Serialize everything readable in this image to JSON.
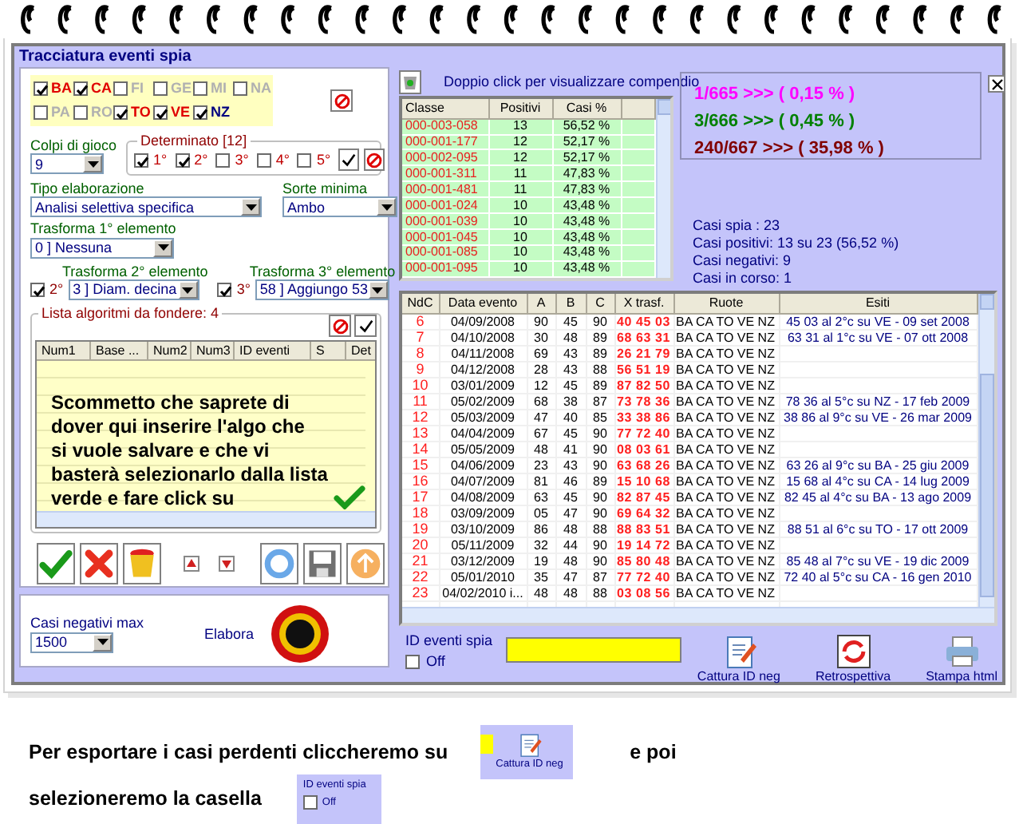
{
  "window": {
    "title": "Tracciatura eventi spia"
  },
  "ruote": [
    {
      "label": "BA",
      "checked": true,
      "color": "#e00000"
    },
    {
      "label": "CA",
      "checked": true,
      "color": "#e00000"
    },
    {
      "label": "FI",
      "checked": false,
      "color": "#b0b0b0"
    },
    {
      "label": "GE",
      "checked": false,
      "color": "#b0b0b0"
    },
    {
      "label": "MI",
      "checked": false,
      "color": "#b0b0b0"
    },
    {
      "label": "NA",
      "checked": false,
      "color": "#b0b0b0"
    },
    {
      "label": "PA",
      "checked": false,
      "color": "#b0b0b0"
    },
    {
      "label": "RO",
      "checked": false,
      "color": "#b0b0b0"
    },
    {
      "label": "TO",
      "checked": true,
      "color": "#e00000"
    },
    {
      "label": "VE",
      "checked": true,
      "color": "#e00000"
    },
    {
      "label": "NZ",
      "checked": true,
      "color": "#000080"
    }
  ],
  "colpi": {
    "label": "Colpi di gioco",
    "value": "9"
  },
  "determinato": {
    "legend": "Determinato [12]",
    "positions": [
      {
        "label": "1°",
        "checked": true
      },
      {
        "label": "2°",
        "checked": true
      },
      {
        "label": "3°",
        "checked": false
      },
      {
        "label": "4°",
        "checked": false
      },
      {
        "label": "5°",
        "checked": false
      }
    ]
  },
  "tipo": {
    "label": "Tipo elaborazione",
    "value": "Analisi selettiva specifica"
  },
  "sorte": {
    "label": "Sorte minima",
    "value": "Ambo"
  },
  "trasforma1": {
    "label": "Trasforma 1° elemento",
    "value": "0 ] Nessuna"
  },
  "trasforma2": {
    "label": "Trasforma 2° elemento",
    "check_label": "2°",
    "checked": true,
    "value": "3 ] Diam. decina"
  },
  "trasforma3": {
    "label": "Trasforma 3° elemento",
    "check_label": "3°",
    "checked": true,
    "value": "58 ] Aggiungo 53"
  },
  "lista": {
    "legend": "Lista algoritmi da fondere: 4",
    "columns": [
      "Num1",
      "Base ...",
      "Num2",
      "Num3",
      "ID eventi",
      "S",
      "Det"
    ],
    "note": "Scommetto che saprete di\ndover qui inserire l'algo che\nsi vuole salvare e che vi\nbasterà selezionarlo dalla lista\nverde e fare click su"
  },
  "casi_negativi": {
    "label": "Casi negativi max",
    "value": "1500"
  },
  "elabora": {
    "label": "Elabora"
  },
  "compendio": {
    "hint": "Doppio click per visualizzare compendio",
    "columns": [
      "Classe",
      "Positivi",
      "Casi %"
    ],
    "rows": [
      [
        "000-003-058",
        "13",
        "56,52 %"
      ],
      [
        "000-001-177",
        "12",
        "52,17 %"
      ],
      [
        "000-002-095",
        "12",
        "52,17 %"
      ],
      [
        "000-001-311",
        "11",
        "47,83 %"
      ],
      [
        "000-001-481",
        "11",
        "47,83 %"
      ],
      [
        "000-001-024",
        "10",
        "43,48 %"
      ],
      [
        "000-001-039",
        "10",
        "43,48 %"
      ],
      [
        "000-001-045",
        "10",
        "43,48 %"
      ],
      [
        "000-001-085",
        "10",
        "43,48 %"
      ],
      [
        "000-001-095",
        "10",
        "43,48 %"
      ]
    ]
  },
  "stats": [
    {
      "text": "1/665 >>> ( 0,15 % )",
      "color": "#ff00ff"
    },
    {
      "text": "3/666 >>> ( 0,45 % )",
      "color": "#008000"
    },
    {
      "text": "240/667 >>> ( 35,98 % )",
      "color": "#800000"
    }
  ],
  "summary": [
    "Casi spia : 23",
    "Casi positivi: 13 su 23 (56,52 %)",
    "Casi negativi: 9",
    "Casi in corso: 1"
  ],
  "eventi": {
    "columns": [
      "NdC",
      "Data evento",
      "A",
      "B",
      "C",
      "X trasf.",
      "Ruote",
      "Esiti"
    ],
    "rows": [
      {
        "ndc": "6",
        "data": "04/09/2008",
        "a": "90",
        "b": "45",
        "c": "90",
        "trasf": "40 45 03",
        "ruote": "BA CA TO VE NZ",
        "esito": "45 03 al 2°c su VE - 09 set 2008"
      },
      {
        "ndc": "7",
        "data": "04/10/2008",
        "a": "30",
        "b": "48",
        "c": "89",
        "trasf": "68 63 31",
        "ruote": "BA CA TO VE NZ",
        "esito": "63 31 al 1°c su VE - 07 ott 2008"
      },
      {
        "ndc": "8",
        "data": "04/11/2008",
        "a": "69",
        "b": "43",
        "c": "89",
        "trasf": "26 21 79",
        "ruote": "BA CA TO VE NZ"
      },
      {
        "ndc": "9",
        "data": "04/12/2008",
        "a": "28",
        "b": "43",
        "c": "88",
        "trasf": "56 51 19",
        "ruote": "BA CA TO VE NZ"
      },
      {
        "ndc": "10",
        "data": "03/01/2009",
        "a": "12",
        "b": "45",
        "c": "89",
        "trasf": "87 82 50",
        "ruote": "BA CA TO VE NZ"
      },
      {
        "ndc": "11",
        "data": "05/02/2009",
        "a": "68",
        "b": "38",
        "c": "87",
        "trasf": "73 78 36",
        "ruote": "BA CA TO VE NZ",
        "esito": "78 36 al 5°c su NZ - 17 feb 2009"
      },
      {
        "ndc": "12",
        "data": "05/03/2009",
        "a": "47",
        "b": "40",
        "c": "85",
        "trasf": "33 38 86",
        "ruote": "BA CA TO VE NZ",
        "esito": "38 86 al 9°c su VE - 26 mar 2009"
      },
      {
        "ndc": "13",
        "data": "04/04/2009",
        "a": "67",
        "b": "45",
        "c": "90",
        "trasf": "77 72 40",
        "ruote": "BA CA TO VE NZ"
      },
      {
        "ndc": "14",
        "data": "05/05/2009",
        "a": "48",
        "b": "41",
        "c": "90",
        "trasf": "08 03 61",
        "ruote": "BA CA TO VE NZ"
      },
      {
        "ndc": "15",
        "data": "04/06/2009",
        "a": "23",
        "b": "43",
        "c": "90",
        "trasf": "63 68 26",
        "ruote": "BA CA TO VE NZ",
        "esito": "63 26 al 9°c su BA - 25 giu 2009"
      },
      {
        "ndc": "16",
        "data": "04/07/2009",
        "a": "81",
        "b": "46",
        "c": "89",
        "trasf": "15 10 68",
        "ruote": "BA CA TO VE NZ",
        "esito": "15 68 al 4°c su CA - 14 lug 2009"
      },
      {
        "ndc": "17",
        "data": "04/08/2009",
        "a": "63",
        "b": "45",
        "c": "90",
        "trasf": "82 87 45",
        "ruote": "BA CA TO VE NZ",
        "esito": "82 45 al 4°c su BA - 13 ago 2009"
      },
      {
        "ndc": "18",
        "data": "03/09/2009",
        "a": "05",
        "b": "47",
        "c": "90",
        "trasf": "69 64 32",
        "ruote": "BA CA TO VE NZ"
      },
      {
        "ndc": "19",
        "data": "03/10/2009",
        "a": "86",
        "b": "48",
        "c": "88",
        "trasf": "88 83 51",
        "ruote": "BA CA TO VE NZ",
        "esito": "88 51 al 6°c su TO - 17 ott 2009"
      },
      {
        "ndc": "20",
        "data": "05/11/2009",
        "a": "32",
        "b": "44",
        "c": "90",
        "trasf": "19 14 72",
        "ruote": "BA CA TO VE NZ"
      },
      {
        "ndc": "21",
        "data": "03/12/2009",
        "a": "19",
        "b": "48",
        "c": "90",
        "trasf": "85 80 48",
        "ruote": "BA CA TO VE NZ",
        "esito": "85 48 al 7°c su VE - 19 dic 2009"
      },
      {
        "ndc": "22",
        "data": "05/01/2010",
        "a": "35",
        "b": "47",
        "c": "87",
        "trasf": "77 72 40",
        "ruote": "BA CA TO VE NZ",
        "esito": "72 40 al 5°c su CA - 16 gen 2010"
      },
      {
        "ndc": "23",
        "data": "04/02/2010 i...",
        "a": "48",
        "b": "48",
        "c": "88",
        "trasf": "03 08 56",
        "ruote": "BA CA TO VE NZ"
      }
    ]
  },
  "id_eventi": {
    "label": "ID eventi spia",
    "off_label": "Off",
    "checked": false
  },
  "tools": [
    {
      "kind": "capture",
      "label": "Cattura ID neg"
    },
    {
      "kind": "retro",
      "label": "Retrospettiva"
    },
    {
      "kind": "print",
      "label": "Stampa html"
    }
  ],
  "instructions": {
    "line1": "Per esportare i casi perdenti cliccheremo su",
    "snapshot1": {
      "caption": "Cattura ID neg"
    },
    "line1_end": "e poi",
    "line2": "selezioneremo la casella",
    "snapshot2": {
      "label": "ID eventi spia",
      "off_label": "Off",
      "checked": false
    }
  }
}
